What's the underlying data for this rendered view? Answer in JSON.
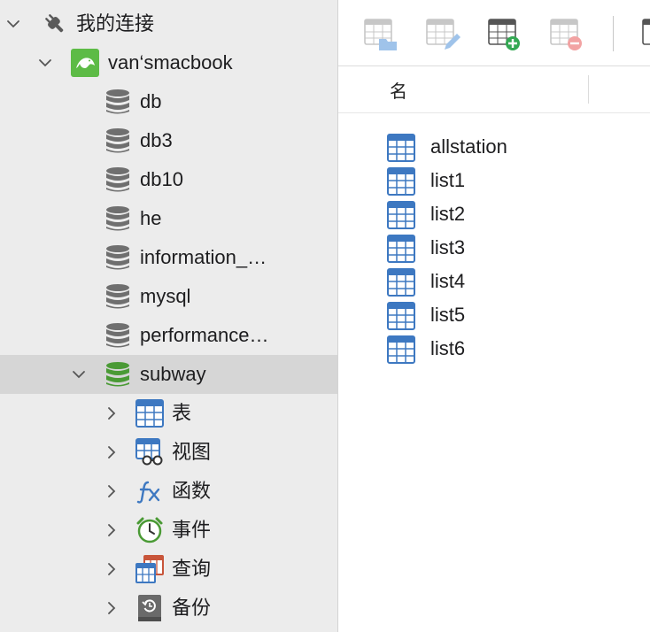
{
  "sidebar": {
    "connection_group": "我的连接",
    "connection": "van‘smacbook",
    "databases": [
      "db",
      "db3",
      "db10",
      "he",
      "information_…",
      "mysql",
      "performance…",
      "subway"
    ],
    "objects": [
      "表",
      "视图",
      "函数",
      "事件",
      "查询",
      "备份"
    ]
  },
  "column_header": {
    "name": "名"
  },
  "tables": [
    "allstation",
    "list1",
    "list2",
    "list3",
    "list4",
    "list5",
    "list6"
  ],
  "colors": {
    "table_blue": "#3d78c1",
    "db_gray": "#6f6f6f",
    "db_green": "#4a9a35",
    "mysql_green": "#5dbb46"
  }
}
